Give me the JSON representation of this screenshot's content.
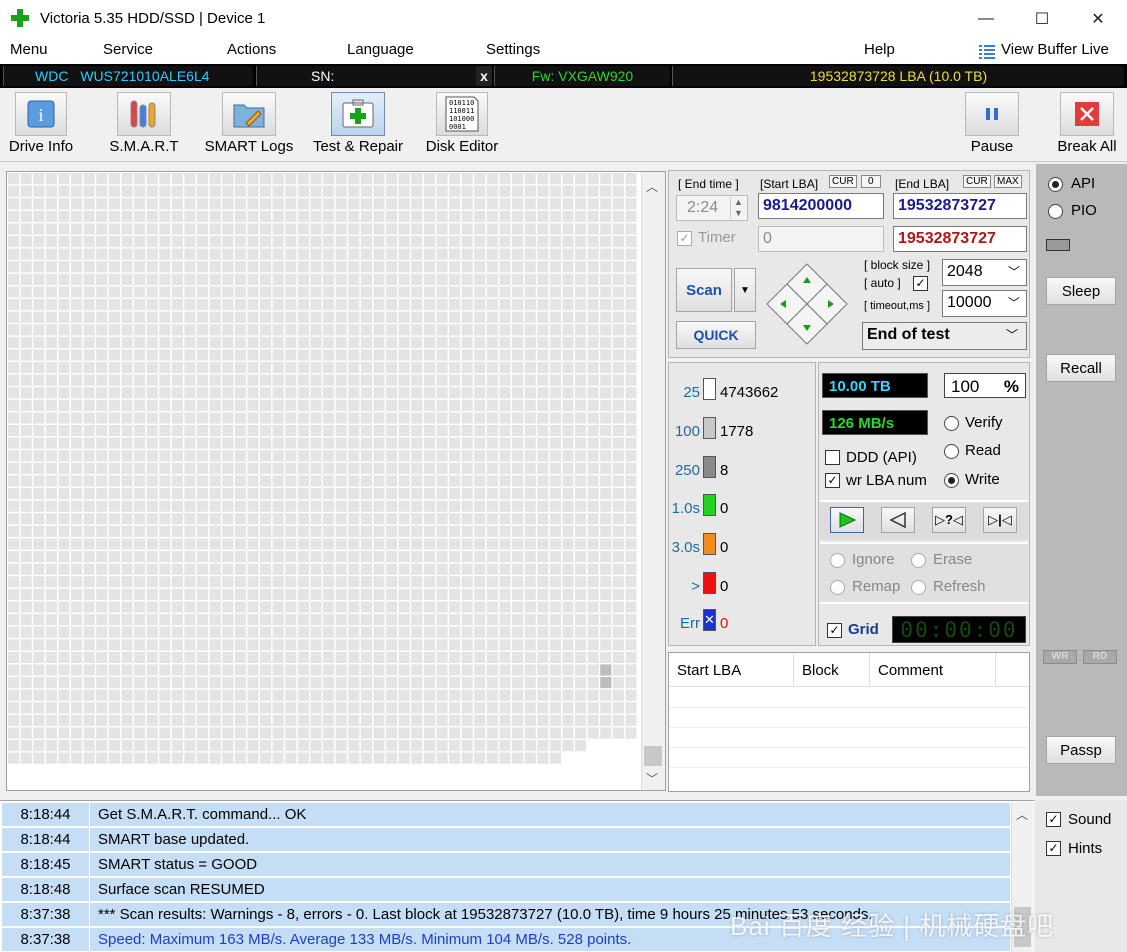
{
  "window": {
    "title": "Victoria 5.35 HDD/SSD | Device 1",
    "minimize": "—",
    "maximize": "☐",
    "close": "✕"
  },
  "menu": {
    "items": [
      "Menu",
      "Service",
      "Actions",
      "Language",
      "Settings",
      "Help"
    ],
    "view_buffer": "View Buffer Live"
  },
  "drive": {
    "vendor": "WDC",
    "model": "WUS721010ALE6L4",
    "sn_label": "SN:",
    "close": "x",
    "firmware": "Fw: VXGAW920",
    "capacity": "19532873728 LBA (10.0 TB)"
  },
  "toolbar": {
    "drive_info": "Drive Info",
    "smart": "S.M.A.R.T",
    "smart_logs": "SMART Logs",
    "test_repair": "Test & Repair",
    "disk_editor": "Disk Editor",
    "pause": "Pause",
    "break_all": "Break All",
    "disk_editor_icon_text": [
      "010110",
      "110011",
      "101000",
      "0001"
    ]
  },
  "scan": {
    "end_time_label": "[ End time ]",
    "end_time": "2:24",
    "start_lba_label": "[Start LBA]",
    "cur": "CUR",
    "zero": "0",
    "start_lba": "9814200000",
    "end_lba_label": "[End LBA]",
    "max": "MAX",
    "end_lba": "19532873727",
    "timer_label": "Timer",
    "timer_value": "0",
    "end_lba_red": "19532873727",
    "scan_button": "Scan",
    "quick_button": "QUICK",
    "block_size_label": "[ block size ]",
    "auto_label": "[ auto ]",
    "timeout_label": "[ timeout,ms ]",
    "block_size": "2048",
    "timeout": "10000",
    "end_action": "End of test"
  },
  "legend": [
    {
      "label": "25",
      "value": "4743662",
      "color": "#ffffff"
    },
    {
      "label": "100",
      "value": "1778",
      "color": "#c8c8c8"
    },
    {
      "label": "250",
      "value": "8",
      "color": "#8a8a8a"
    },
    {
      "label": "1.0s",
      "value": "0",
      "color": "#22d322"
    },
    {
      "label": "3.0s",
      "value": "0",
      "color": "#f08c1e"
    },
    {
      "label": ">",
      "value": "0",
      "color": "#ee1111"
    },
    {
      "label": "Err",
      "value": "0",
      "color": "#1833cc"
    }
  ],
  "status": {
    "capacity": "10.00 TB",
    "percent": "100",
    "percent_sign": "%",
    "speed": "126 MB/s",
    "verify": "Verify",
    "read": "Read",
    "write": "Write",
    "ddd": "DDD (API)",
    "wr_lba": "wr LBA num",
    "ignore": "Ignore",
    "erase": "Erase",
    "remap": "Remap",
    "refresh": "Refresh",
    "grid": "Grid",
    "clock": "00:00:00"
  },
  "defects_table": {
    "columns": [
      "Start LBA",
      "Block",
      "Comment"
    ]
  },
  "side": {
    "api": "API",
    "pio": "PIO",
    "sleep": "Sleep",
    "recall": "Recall",
    "wr": "WR",
    "rd": "RD",
    "passp": "Passp",
    "sound": "Sound",
    "hints": "Hints"
  },
  "log": [
    {
      "time": "8:18:44",
      "msg": "Get S.M.A.R.T. command... OK"
    },
    {
      "time": "8:18:44",
      "msg": "SMART base updated."
    },
    {
      "time": "8:18:45",
      "msg": "SMART status = GOOD"
    },
    {
      "time": "8:18:48",
      "msg": "Surface scan RESUMED"
    },
    {
      "time": "8:37:38",
      "msg": "*** Scan results: Warnings - 8, errors - 0. Last block at 19532873727 (10.0 TB), time 9 hours 25 minutes 53 seconds."
    },
    {
      "time": "8:37:38",
      "msg": "Speed: Maximum 163 MB/s. Average 133 MB/s. Minimum 104 MB/s. 528 points."
    }
  ],
  "watermark": "Bai 百度 经验 | 机械硬盘吧"
}
